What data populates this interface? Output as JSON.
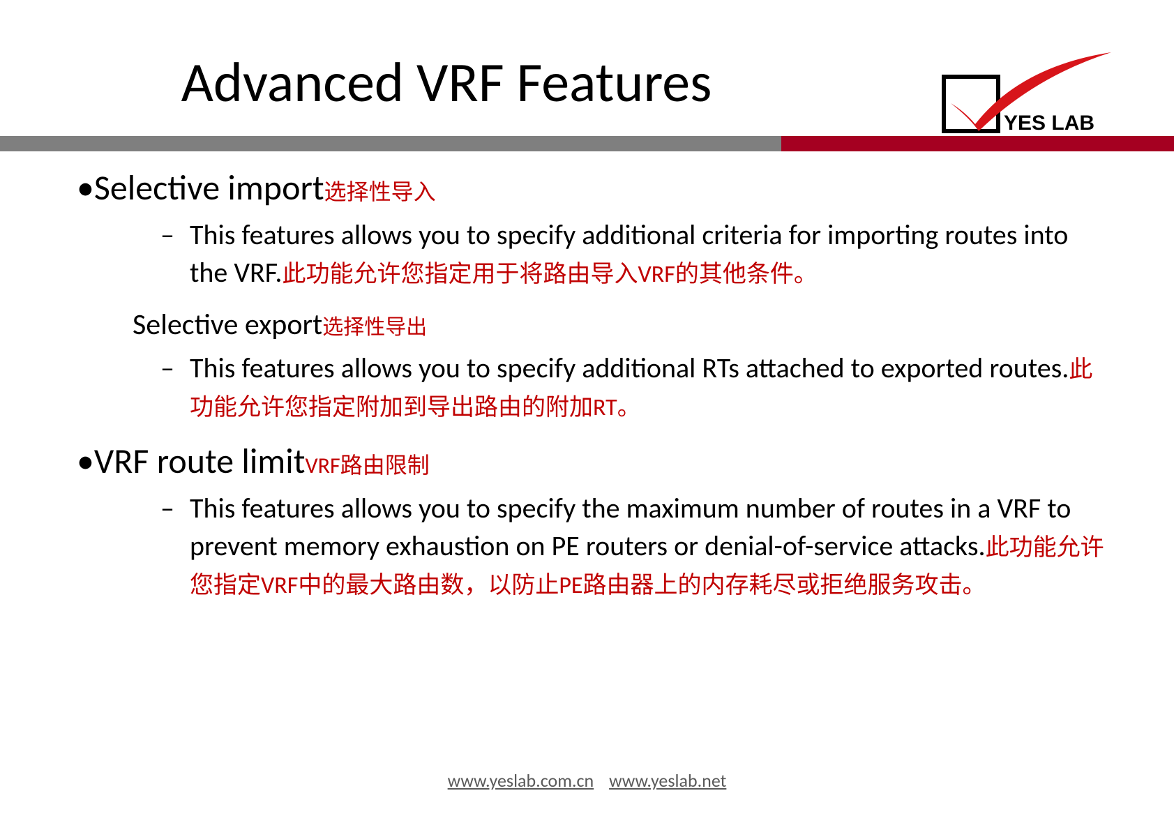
{
  "title": "Advanced VRF Features",
  "logo": {
    "text": "YES LAB"
  },
  "content": {
    "b1": {
      "label_en": "Selective import",
      "label_zh": "选择性导入",
      "sub1_en": "This features allows you to specify additional criteria for importing routes into the VRF.",
      "sub1_zh": "此功能允许您指定用于将路由导入VRF的其他条件。"
    },
    "b2": {
      "label_en": "Selective export",
      "label_zh": "选择性导出",
      "sub1_en": "This features allows you to specify additional RTs attached to exported routes.",
      "sub1_zh": "此功能允许您指定附加到导出路由的附加RT。"
    },
    "b3": {
      "label_en": "VRF  route limit",
      "label_zh": "VRF路由限制",
      "sub1_en": "This features allows you to specify the maximum number of routes in a VRF to prevent memory exhaustion on PE routers or denial-of-service attacks.",
      "sub1_zh": "此功能允许您指定VRF中的最大路由数，以防止PE路由器上的内存耗尽或拒绝服务攻击。"
    }
  },
  "footer": {
    "link1": "www.yeslab.com.cn",
    "link2": "www.yeslab.net"
  }
}
